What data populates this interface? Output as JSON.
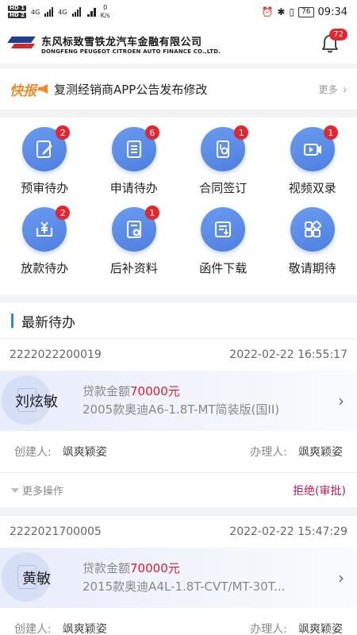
{
  "status_bar": {
    "sim1": "HD 1",
    "sim2": "HD 2",
    "net1": "4G",
    "net2": "4G",
    "speed_value": "0",
    "speed_unit": "K/s",
    "battery": "76",
    "time": "09:34"
  },
  "header": {
    "company_cn": "东风标致雪铁龙汽车金融有限公司",
    "company_en": "DONGFENG PEUGEOT CITROEN AUTO FINANCE CO.,LTD.",
    "notification_count": "72"
  },
  "notice": {
    "label": "快报",
    "text": "复测经销商APP公告发布修改",
    "more": "更多"
  },
  "quick_menu": [
    {
      "label": "预审待办",
      "badge": "2",
      "icon": "edit-doc-icon"
    },
    {
      "label": "申请待办",
      "badge": "6",
      "icon": "list-doc-icon"
    },
    {
      "label": "合同签订",
      "badge": "1",
      "icon": "contract-icon"
    },
    {
      "label": "视频双录",
      "badge": "1",
      "icon": "video-icon"
    },
    {
      "label": "放款待办",
      "badge": "2",
      "icon": "yuan-icon"
    },
    {
      "label": "后补资料",
      "badge": "1",
      "icon": "add-doc-icon"
    },
    {
      "label": "函件下载",
      "badge": "",
      "icon": "download-doc-icon"
    },
    {
      "label": "敬请期待",
      "badge": "",
      "icon": "apps-icon"
    }
  ],
  "todo": {
    "title": "最新待办",
    "loan_label": "贷款金额",
    "creator_label": "创建人:",
    "handler_label": "办理人:",
    "more_ops": "更多操作",
    "items": [
      {
        "id": "2222022200019",
        "datetime": "2022-02-22 16:55:17",
        "name": "刘炫敏",
        "amount": "70000元",
        "car": "2005款奥迪A6-1.8T-MT简装版(国II)",
        "creator": "飒爽颖姿",
        "handler": "飒爽颖姿",
        "status": "拒绝(审批)"
      },
      {
        "id": "2222021700005",
        "datetime": "2022-02-22 15:47:29",
        "name": "黄敏",
        "amount": "70000元",
        "car": "2015款奥迪A4L-1.8T-CVT/MT-30T...",
        "creator": "飒爽颖姿",
        "handler": "飒爽颖姿",
        "status": ""
      }
    ]
  },
  "colors": {
    "accent_blue": "#3f7de8",
    "badge_red": "#e4262e",
    "notice_orange": "#f08a2a",
    "amount_red": "#d81e2a",
    "reject_pink": "#c2185b"
  }
}
